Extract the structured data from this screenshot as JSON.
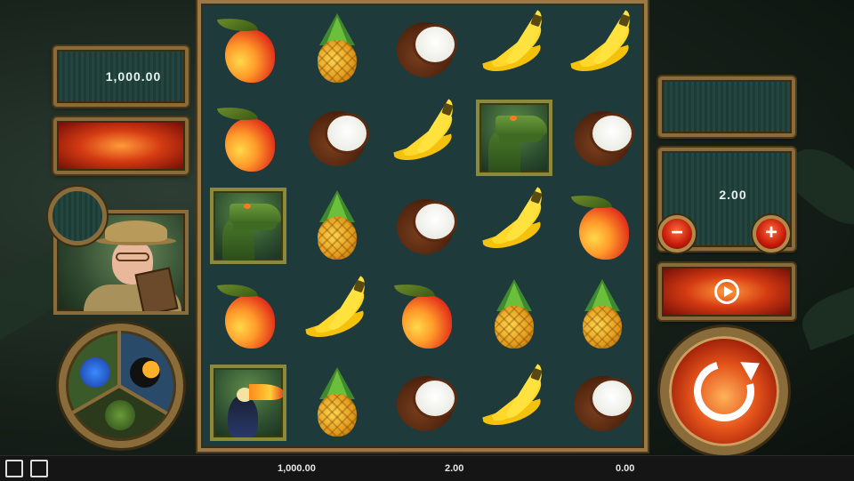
{
  "balance_display": "1,000.00",
  "bet_display": "2.00",
  "bottom_bar": {
    "balance": "1,000.00",
    "bet": "2.00",
    "win": "0.00"
  },
  "bet_controls": {
    "minus_label": "−",
    "plus_label": "+"
  },
  "reels": [
    [
      "mango",
      "pineapple",
      "coconut",
      "banana",
      "banana"
    ],
    [
      "mango",
      "coconut",
      "banana",
      "crocodile",
      "coconut"
    ],
    [
      "crocodile",
      "pineapple",
      "coconut",
      "banana",
      "mango"
    ],
    [
      "mango",
      "banana",
      "mango",
      "pineapple",
      "pineapple"
    ],
    [
      "toucan",
      "pineapple",
      "coconut",
      "banana",
      "coconut"
    ]
  ],
  "icons": {
    "fullscreen": "fullscreen-icon",
    "video": "video-icon",
    "autoplay": "autoplay-icon",
    "spin": "spin-icon"
  },
  "colors": {
    "frame_bronze": "#8a6b3a",
    "panel_teal": "#1d3c38",
    "button_red": "#c41a0a"
  }
}
